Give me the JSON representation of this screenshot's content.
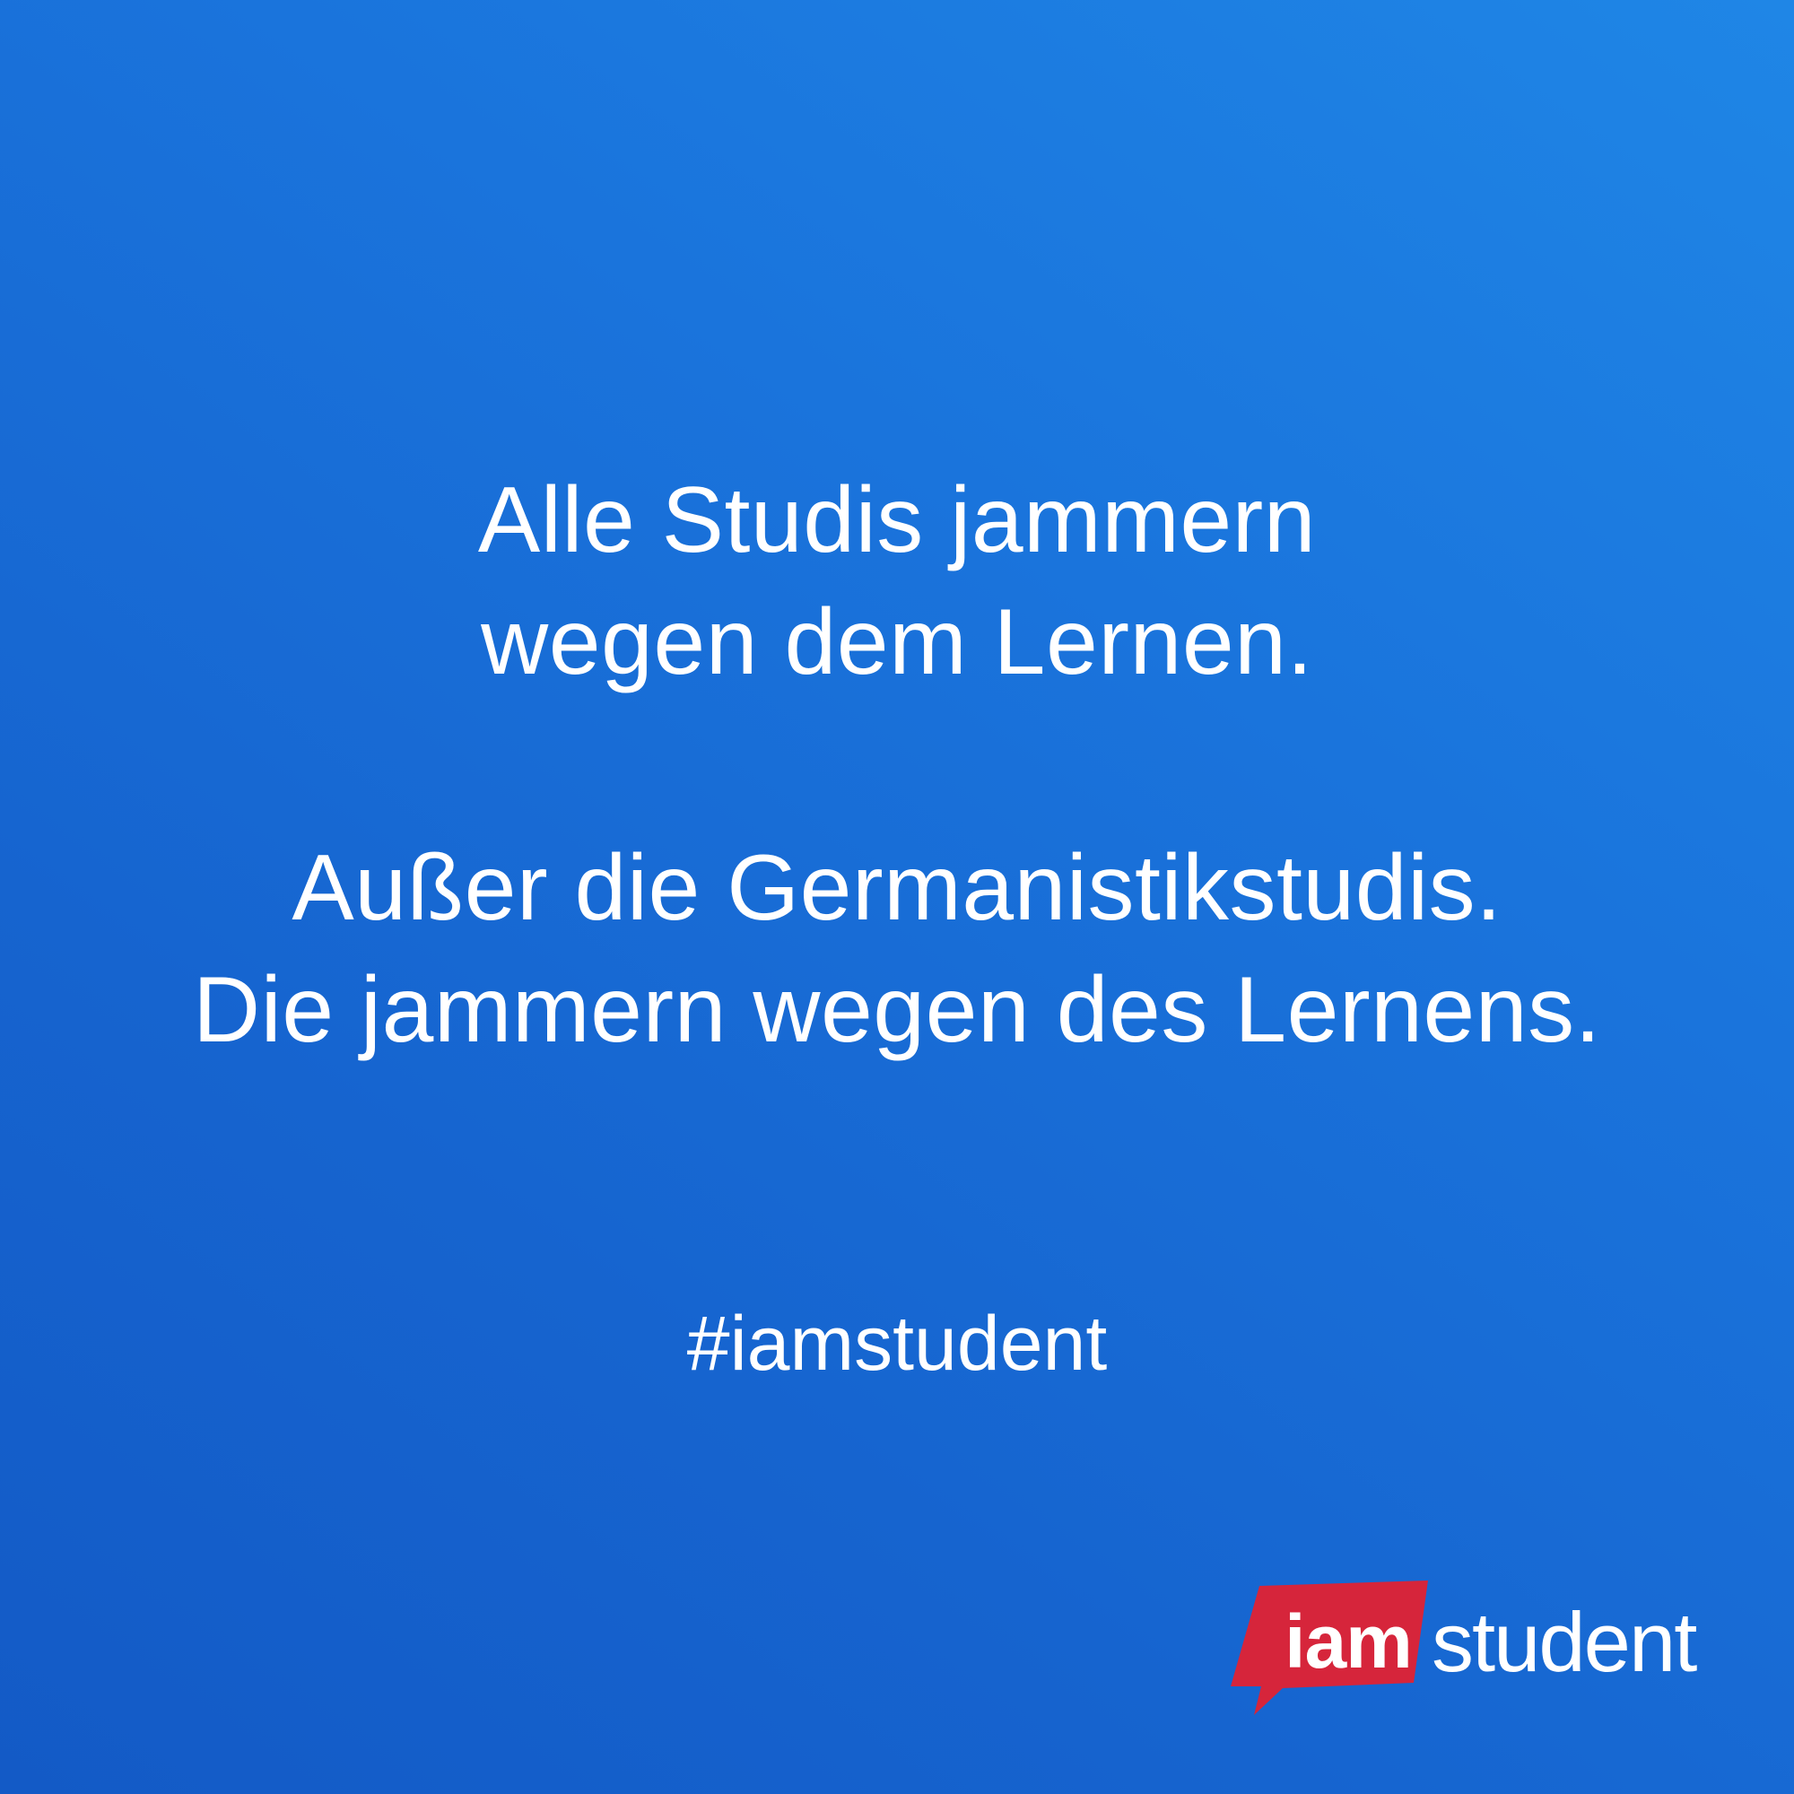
{
  "message": {
    "block1": {
      "line1": "Alle Studis jammern",
      "line2": "wegen dem Lernen."
    },
    "block2": {
      "line1": "Außer die Germanistikstudis.",
      "line2": "Die jammern wegen des Lernens."
    }
  },
  "hashtag": "#iamstudent",
  "logo": {
    "iam": "iam",
    "student": "student"
  },
  "colors": {
    "background_top_right": "#1f86e6",
    "background_bottom_left": "#135ac6",
    "text": "#ffffff",
    "logo_badge": "#d6253b"
  }
}
